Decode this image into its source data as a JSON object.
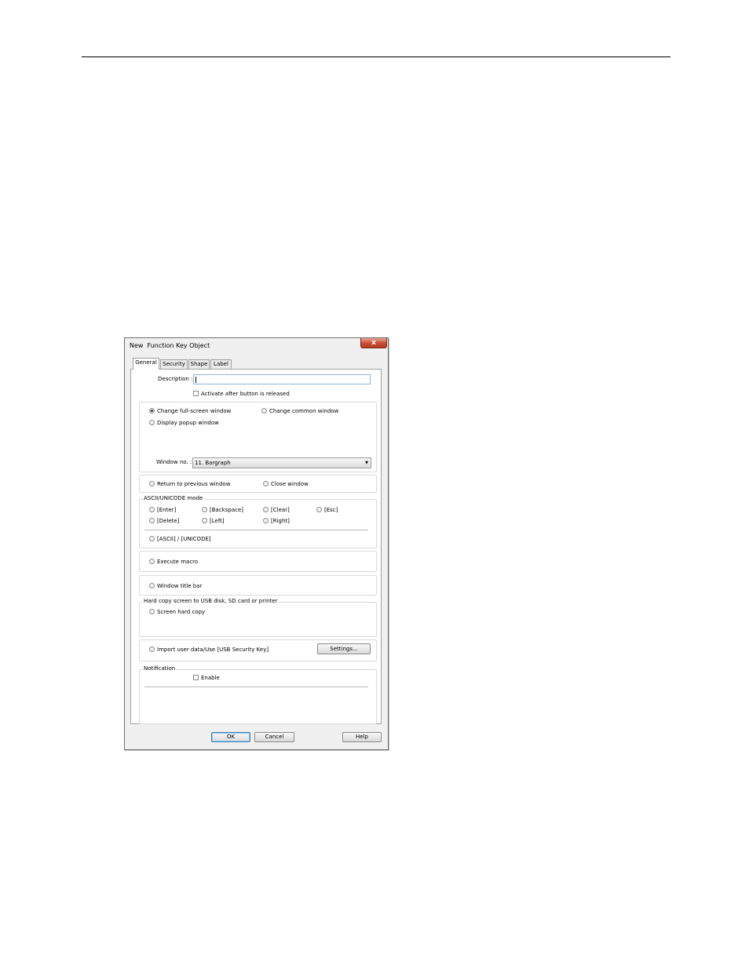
{
  "dialog": {
    "title": "New  Function Key Object",
    "close_symbol": "x"
  },
  "tabs": [
    {
      "label": "General",
      "active": true
    },
    {
      "label": "Security",
      "active": false
    },
    {
      "label": "Shape",
      "active": false
    },
    {
      "label": "Label",
      "active": false
    }
  ],
  "general": {
    "description_label": "Description :",
    "description_value": "",
    "activate_after_release": {
      "label": "Activate after button is released",
      "checked": false
    },
    "window_options": {
      "change_fullscreen": {
        "label": "Change full-screen window",
        "checked": true
      },
      "change_common": {
        "label": "Change common window",
        "checked": false
      },
      "display_popup": {
        "label": "Display popup window",
        "checked": false
      }
    },
    "window_no_label": "Window no. :",
    "window_no_value": "11. Bargraph",
    "return_previous": "Return to previous window",
    "close_window": "Close window",
    "ascii_group_title": "ASCII/UNICODE mode",
    "ascii_keys": [
      "[Enter]",
      "[Backspace]",
      "[Clear]",
      "[Esc]",
      "[Delete]",
      "[Left]",
      "[Right]"
    ],
    "ascii_unicode": "[ASCII] / [UNICODE]",
    "execute_macro": "Execute macro",
    "window_title_bar": "Window title bar",
    "hard_copy_group_title": "Hard copy screen to USB disk, SD card or printer",
    "screen_hard_copy": "Screen hard copy",
    "import_user_data": "Import user data/Use [USB Security Key]",
    "settings_button": "Settings...",
    "notification_group_title": "Notification",
    "notification_enable": {
      "label": "Enable",
      "checked": false
    }
  },
  "footer": {
    "ok": "OK",
    "cancel": "Cancel",
    "help": "Help"
  }
}
